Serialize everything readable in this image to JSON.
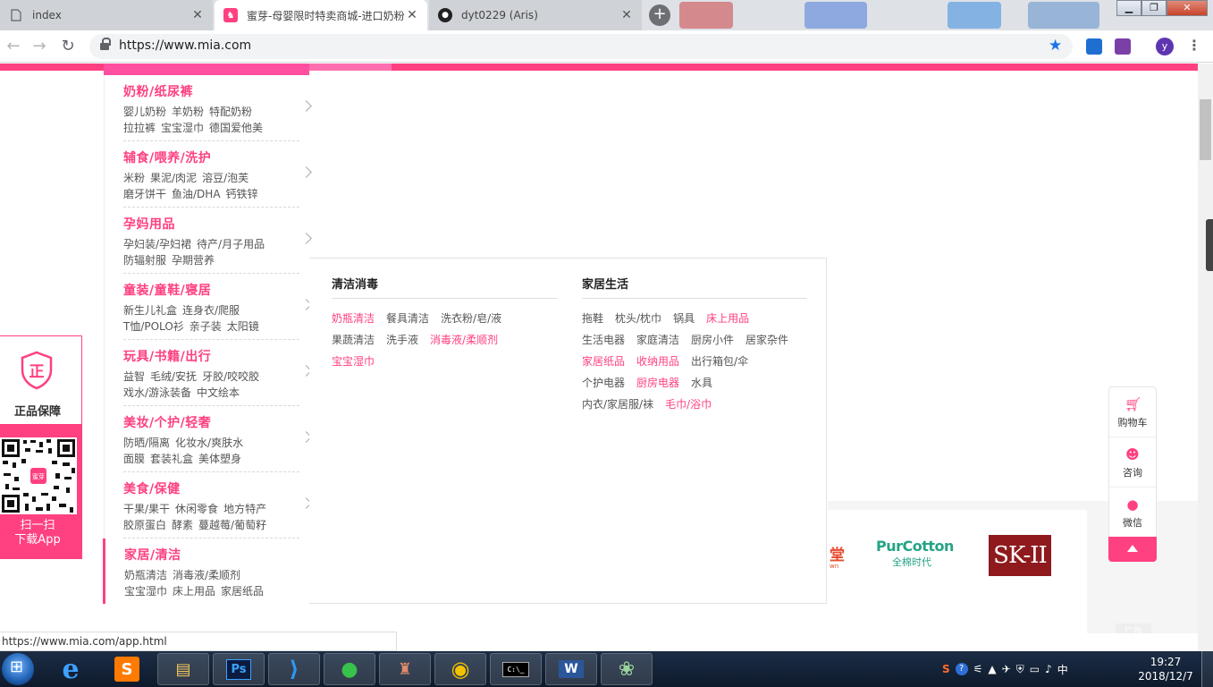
{
  "browser": {
    "tabs": [
      {
        "title": "index",
        "icon": "page-icon",
        "active": false
      },
      {
        "title": "蜜芽-母婴限时特卖商城-进口奶粉",
        "icon": "mia-icon",
        "active": true
      },
      {
        "title": "dyt0229 (Aris)",
        "icon": "github-icon",
        "active": false
      }
    ],
    "url": "https://www.mia.com",
    "profile_initial": "y"
  },
  "category_menu": [
    {
      "title": "奶粉/纸尿裤",
      "line1": [
        "婴儿奶粉",
        "羊奶粉",
        "特配奶粉"
      ],
      "line2": [
        "拉拉裤",
        "宝宝湿巾",
        "德国爱他美"
      ]
    },
    {
      "title": "辅食/喂养/洗护",
      "line1": [
        "米粉",
        "果泥/肉泥",
        "溶豆/泡芙"
      ],
      "line2": [
        "磨牙饼干",
        "鱼油/DHA",
        "钙铁锌"
      ]
    },
    {
      "title": "孕妈用品",
      "line1": [
        "孕妇装/孕妇裙",
        "待产/月子用品"
      ],
      "line2": [
        "防辐射服",
        "孕期营养"
      ]
    },
    {
      "title": "童装/童鞋/寝居",
      "line1": [
        "新生儿礼盒",
        "连身衣/爬服"
      ],
      "line2": [
        "T恤/POLO衫",
        "亲子装",
        "太阳镜"
      ]
    },
    {
      "title": "玩具/书籍/出行",
      "line1": [
        "益智",
        "毛绒/安抚",
        "牙胶/咬咬胶"
      ],
      "line2": [
        "戏水/游泳装备",
        "中文绘本"
      ]
    },
    {
      "title": "美妆/个护/轻奢",
      "line1": [
        "防晒/隔离",
        "化妆水/爽肤水"
      ],
      "line2": [
        "面膜",
        "套装礼盒",
        "美体塑身"
      ]
    },
    {
      "title": "美食/保健",
      "line1": [
        "干果/果干",
        "休闲零食",
        "地方特产"
      ],
      "line2": [
        "胶原蛋白",
        "酵素",
        "蔓越莓/葡萄籽"
      ]
    },
    {
      "title": "家居/清洁",
      "line1": [
        "奶瓶清洁",
        "消毒液/柔顺剂"
      ],
      "line2": [
        "宝宝湿巾",
        "床上用品",
        "家居纸品"
      ]
    }
  ],
  "submenu": {
    "col1": {
      "heading": "清洁消毒",
      "rows": [
        [
          {
            "t": "奶瓶清洁",
            "hot": true
          },
          {
            "t": "餐具清洁",
            "hot": false
          },
          {
            "t": "洗衣粉/皂/液",
            "hot": false
          }
        ],
        [
          {
            "t": "果蔬清洁",
            "hot": false
          },
          {
            "t": "洗手液",
            "hot": false
          },
          {
            "t": "消毒液/柔顺剂",
            "hot": true
          }
        ],
        [
          {
            "t": "宝宝湿巾",
            "hot": true
          }
        ]
      ]
    },
    "col2": {
      "heading": "家居生活",
      "rows": [
        [
          {
            "t": "拖鞋",
            "hot": false
          },
          {
            "t": "枕头/枕巾",
            "hot": false
          },
          {
            "t": "锅具",
            "hot": false
          },
          {
            "t": "床上用品",
            "hot": true
          }
        ],
        [
          {
            "t": "生活电器",
            "hot": false
          },
          {
            "t": "家庭清洁",
            "hot": false
          },
          {
            "t": "厨房小件",
            "hot": false
          },
          {
            "t": "居家杂件",
            "hot": false
          }
        ],
        [
          {
            "t": "家居纸品",
            "hot": true
          },
          {
            "t": "收纳用品",
            "hot": true
          },
          {
            "t": "出行箱包/伞",
            "hot": false
          }
        ],
        [
          {
            "t": "个护电器",
            "hot": false
          },
          {
            "t": "厨房电器",
            "hot": true
          },
          {
            "t": "水具",
            "hot": false
          }
        ],
        [
          {
            "t": "内衣/家居服/袜",
            "hot": false
          },
          {
            "t": "毛巾/浴巾",
            "hot": true
          }
        ]
      ]
    }
  },
  "brands": {
    "cut_logo": "堂",
    "cut_logo_sub": "wn",
    "purcotton_en": "PurCotton",
    "purcotton_cn": "全棉时代",
    "skii": "SK-II"
  },
  "float_left": {
    "badge_char": "正",
    "badge_label": "正品保障",
    "qr_center": "蜜芽",
    "scan_line1": "扫一扫",
    "scan_line2": "下载App"
  },
  "float_right": [
    {
      "label": "购物车",
      "icon": "cart-icon"
    },
    {
      "label": "咨询",
      "icon": "consult-icon"
    },
    {
      "label": "微信",
      "icon": "wechat-icon"
    }
  ],
  "ad_label": "广告",
  "status_url": "https://www.mia.com/app.html",
  "taskbar": {
    "apps": [
      {
        "name": "ie-icon",
        "glyph": "e"
      },
      {
        "name": "sublime-icon",
        "glyph": "S"
      },
      {
        "name": "explorer-icon",
        "glyph": "▤"
      },
      {
        "name": "photoshop-icon",
        "glyph": "Ps"
      },
      {
        "name": "vscode-icon",
        "glyph": "⟩"
      },
      {
        "name": "wechat-icon",
        "glyph": "●"
      },
      {
        "name": "game-icon",
        "glyph": "♜"
      },
      {
        "name": "chrome-icon",
        "glyph": "◉"
      },
      {
        "name": "cmd-icon",
        "glyph": "C:\\_"
      },
      {
        "name": "word-icon",
        "glyph": "W"
      },
      {
        "name": "app-icon",
        "glyph": "❀"
      }
    ],
    "time": "19:27",
    "date": "2018/12/7"
  },
  "colors": {
    "accent": "#ff4081",
    "skii": "#8e1a1d",
    "purcotton": "#26a386"
  }
}
